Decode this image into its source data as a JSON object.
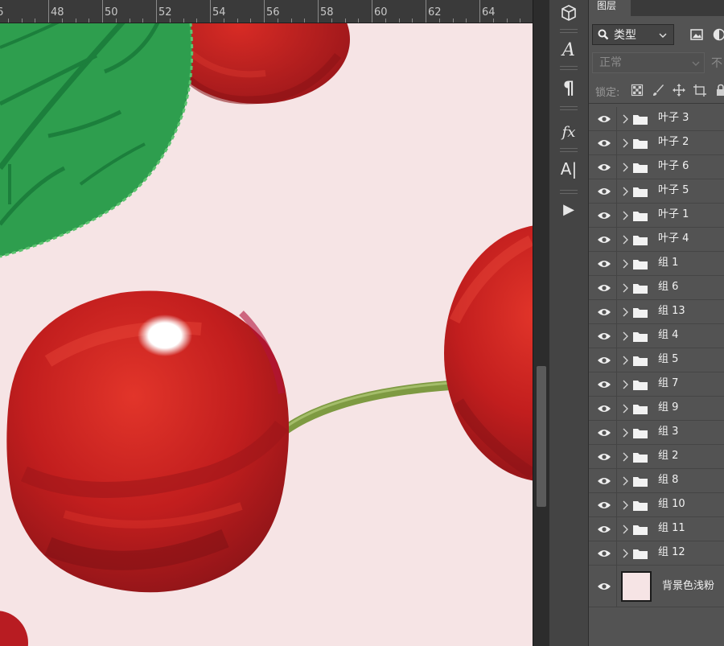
{
  "ruler": {
    "labels": [
      "6",
      "48",
      "50",
      "52",
      "54",
      "56",
      "58",
      "60",
      "62",
      "64"
    ]
  },
  "tools": {
    "items": [
      {
        "name": "3d-icon"
      },
      {
        "name": "character-icon",
        "glyph": "A"
      },
      {
        "name": "paragraph-icon",
        "glyph": "¶"
      },
      {
        "name": "fx-icon",
        "glyph": "fx"
      },
      {
        "name": "glyphs-icon",
        "glyph": "A|"
      },
      {
        "name": "play-icon",
        "glyph": "▶"
      }
    ]
  },
  "layers_panel": {
    "tab": "图层",
    "filter": {
      "label": "类型"
    },
    "blend_mode": "正常",
    "opacity_label": "不",
    "lock_label": "锁定:",
    "layers": [
      {
        "name": "叶子 3"
      },
      {
        "name": "叶子 2"
      },
      {
        "name": "叶子 6"
      },
      {
        "name": "叶子 5"
      },
      {
        "name": "叶子 1"
      },
      {
        "name": "叶子 4"
      },
      {
        "name": "组 1"
      },
      {
        "name": "组 6"
      },
      {
        "name": "组 13"
      },
      {
        "name": "组 4"
      },
      {
        "name": "组 5"
      },
      {
        "name": "组 7"
      },
      {
        "name": "组 9"
      },
      {
        "name": "组 3"
      },
      {
        "name": "组 2"
      },
      {
        "name": "组 8"
      },
      {
        "name": "组 10"
      },
      {
        "name": "组 11"
      },
      {
        "name": "组 12"
      }
    ],
    "background_layer": {
      "name": "背景色浅粉",
      "color": "#f6e4e5"
    }
  },
  "colors": {
    "canvas_bg": "#f6e4e5",
    "cherry_red": "#c51d1d",
    "leaf_green": "#2e9e4e",
    "panel_bg": "#535353"
  }
}
